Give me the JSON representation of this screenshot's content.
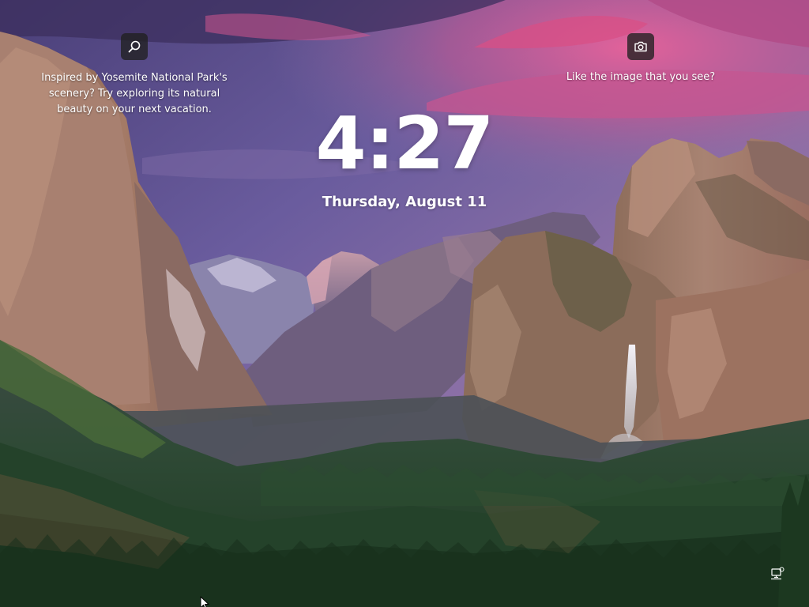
{
  "lock_screen": {
    "time": "4:27",
    "date": "Thursday, August 11"
  },
  "spotlight": {
    "info_text": "Inspired by Yosemite National Park's scenery? Try exploring its natural beauty on your next vacation.",
    "like_text": "Like the image that you see?"
  },
  "icons": {
    "search": "search-icon",
    "camera": "camera-icon",
    "network": "network-icon",
    "cursor": "mouse-pointer-icon"
  },
  "colors": {
    "text": "#ffffff",
    "icon_button_bg": "#202020"
  }
}
